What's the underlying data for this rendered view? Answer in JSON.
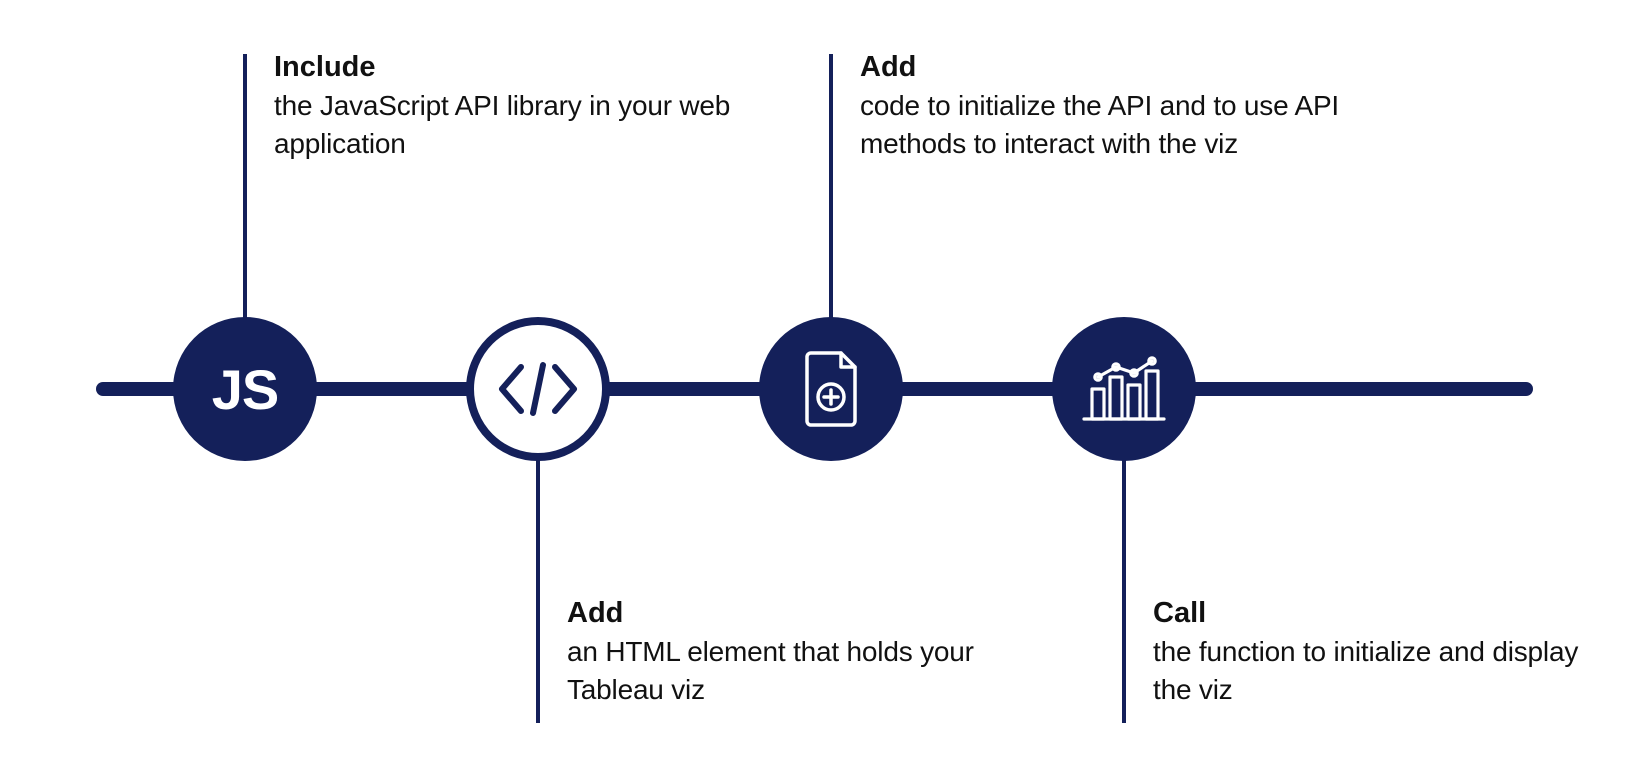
{
  "colors": {
    "navy": "#14205a"
  },
  "steps": [
    {
      "icon": "js-text",
      "strong": "Include",
      "body": "the JavaScript API library in your web application",
      "position": "top"
    },
    {
      "icon": "code-brackets",
      "strong": "Add",
      "body": "an HTML element that holds your Tableau viz",
      "position": "bottom"
    },
    {
      "icon": "file-add",
      "strong": "Add",
      "body": "code to initialize the API and to use API methods to interact with the viz",
      "position": "top"
    },
    {
      "icon": "chart",
      "strong": "Call",
      "body": "the function to initialize and display the viz",
      "position": "bottom"
    }
  ]
}
